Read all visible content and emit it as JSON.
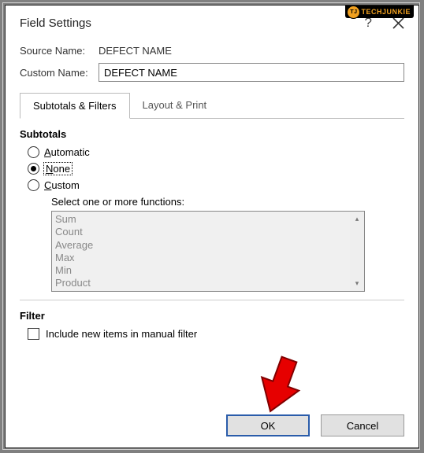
{
  "badge": "TECHJUNKIE",
  "dialog": {
    "title": "Field Settings",
    "source_name_label": "Source Name:",
    "source_name_value": "DEFECT NAME",
    "custom_name_label": "Custom Name:",
    "custom_name_value": "DEFECT NAME",
    "tabs": [
      {
        "label": "Subtotals & Filters",
        "active": true
      },
      {
        "label": "Layout & Print",
        "active": false
      }
    ],
    "subtotals": {
      "heading": "Subtotals",
      "options": {
        "automatic_pre": "A",
        "automatic_rest": "utomatic",
        "none_pre": "N",
        "none_rest": "one",
        "custom_pre": "C",
        "custom_rest": "ustom"
      },
      "functions_label": "Select one or more functions:",
      "functions": [
        "Sum",
        "Count",
        "Average",
        "Max",
        "Min",
        "Product"
      ]
    },
    "filter": {
      "heading": "Filter",
      "include_label": "Include new items in manual filter"
    },
    "buttons": {
      "ok": "OK",
      "cancel": "Cancel"
    }
  }
}
